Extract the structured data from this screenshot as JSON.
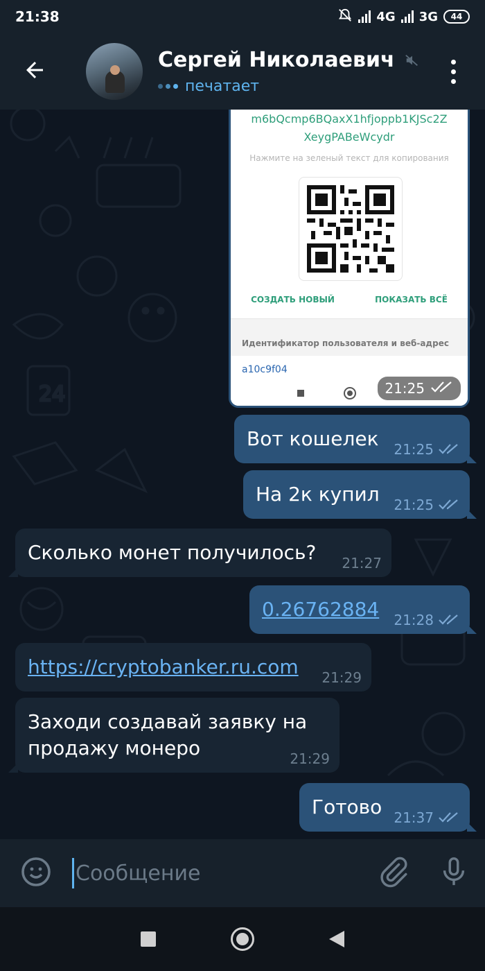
{
  "status_bar": {
    "time": "21:38",
    "network_1": "4G",
    "network_2": "3G",
    "battery": "44"
  },
  "header": {
    "contact_name": "Сергей Николаевич",
    "status": "печатает"
  },
  "image_message": {
    "wallet_address_line1": "m6bQcmp6BQaxX1hfjoppb1KJSc2Z",
    "wallet_address_line2": "XeygPABeWcydr",
    "copy_hint": "Нажмите на зеленый текст для копирования",
    "create_new": "СОЗДАТЬ НОВЫЙ",
    "show_all": "ПОКАЗАТЬ ВСЁ",
    "id_label": "Идентификатор пользователя и веб-адрес",
    "id_value": "a10c9f04",
    "time": "21:25"
  },
  "messages": [
    {
      "direction": "out",
      "text": "Вот кошелек",
      "time": "21:25"
    },
    {
      "direction": "out",
      "text": "На 2к купил",
      "time": "21:25"
    },
    {
      "direction": "in",
      "text": "Сколько монет получилось?",
      "time": "21:27"
    },
    {
      "direction": "out",
      "text": "0.26762884",
      "time": "21:28",
      "is_link": true
    },
    {
      "direction": "in",
      "text": "https://cryptobanker.ru.com",
      "time": "21:29",
      "is_link": true
    },
    {
      "direction": "in",
      "text_line1": "Заходи создавай заявку на",
      "text_line2": "продажу монеро",
      "time": "21:29"
    },
    {
      "direction": "out",
      "text": "Готово",
      "time": "21:37"
    }
  ],
  "input": {
    "placeholder": "Сообщение"
  },
  "colors": {
    "chat_bg": "#0e1621",
    "bar_bg": "#17212b",
    "outgoing_bubble": "#2b5278",
    "incoming_bubble": "#182533",
    "accent": "#5fb4ef",
    "link": "#6ab3f3"
  },
  "icons": {
    "back": "arrow-left-icon",
    "muted": "muted-icon",
    "menu": "more-vertical-icon",
    "emoji": "smiley-icon",
    "attach": "paperclip-icon",
    "mic": "microphone-icon",
    "read": "double-check-icon"
  }
}
